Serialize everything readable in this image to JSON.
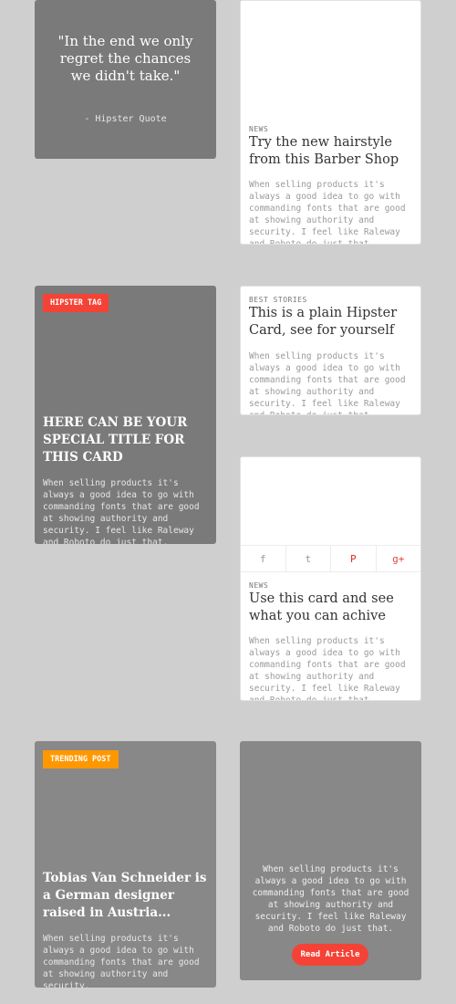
{
  "quote_card": {
    "quote": "\"In the end we only regret the chances we didn't take.\"",
    "author": "- Hipster Quote"
  },
  "news_card_1": {
    "category": "NEWS",
    "title": "Try the new hairstyle from this Barber Shop",
    "body": "When selling products it's always a good idea to go with commanding fonts that are good at showing authority and security. I feel like Raleway and Roboto do just that."
  },
  "hipster_card": {
    "tag": "HIPSTER TAG",
    "title": "HERE CAN BE YOUR SPECIAL TITLE FOR THIS CARD",
    "body": "When selling products it's always a good idea to go with commanding fonts that are good at showing authority and security. I feel like Raleway and Roboto do just that."
  },
  "best_stories_card": {
    "category": "BEST STORIES",
    "title": "This is a plain Hipster Card, see for yourself",
    "body": "When selling products it's always a good idea to go with commanding fonts that are good at showing authority and security. I feel like Raleway and Roboto do just that."
  },
  "social_card": {
    "social_icons": [
      "facebook-icon",
      "twitter-icon",
      "pinterest-icon",
      "google-plus-icon"
    ],
    "social_glyphs": {
      "facebook": "f",
      "twitter": "t",
      "pinterest": "P",
      "gplus": "g+"
    },
    "category": "NEWS",
    "title": "Use this card and see what you can achive",
    "body": "When selling products it's always a good idea to go with commanding fonts that are good at showing authority and security. I feel like Raleway and Roboto do just that."
  },
  "trending_card": {
    "tag": "TRENDING POST",
    "title": "Tobias Van Schneider is a German designer raised in Austria...",
    "body": "When selling products it's always a good idea to go with commanding fonts that are good at showing authority and security."
  },
  "article_card": {
    "body": "When selling products it's always a good idea to go with commanding fonts that are good at showing authority and security. I feel like Raleway and Roboto do just that.",
    "button_label": "Read Article"
  },
  "colors": {
    "background": "#cfcfcf",
    "card_gray": "#7a7a7a",
    "tag_red": "#f44336",
    "tag_orange": "#ff9800"
  }
}
